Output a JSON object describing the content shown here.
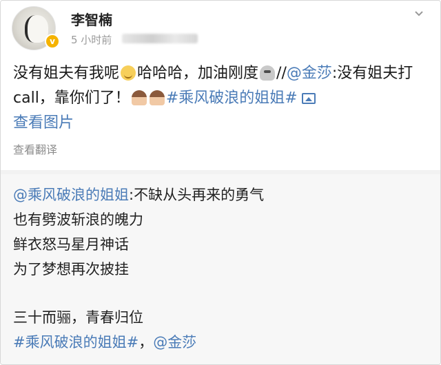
{
  "post": {
    "username": "李智楠",
    "time": "5 小时前",
    "body_part1": "没有姐夫有我呢",
    "body_part2": "哈哈哈，加油刚度",
    "body_part3": "//",
    "mention_jinsha": "@金莎",
    "body_part4": ":没有姐夫打 call，靠你们了！",
    "hashtag": "#乘风破浪的姐姐#",
    "view_image": "查看图片",
    "translate": "查看翻译"
  },
  "repost": {
    "mention_sisters": "@乘风破浪的姐姐",
    "line1_rest": ":不缺从头再来的勇气",
    "line2": "也有劈波斩浪的魄力",
    "line3": "鲜衣怒马星月神话",
    "line4": "为了梦想再次披挂",
    "line5": "三十而骊，青春归位",
    "hashtag": "#乘风破浪的姐姐#",
    "separator": "，",
    "mention_jinsha": "@金莎"
  },
  "icons": {
    "verified": "verified-badge-icon",
    "chevron": "chevron-down-icon",
    "image": "image-icon"
  },
  "colors": {
    "link": "#4a7bb7",
    "repost_bg": "#f7f7f7",
    "verified": "#f5b300"
  }
}
